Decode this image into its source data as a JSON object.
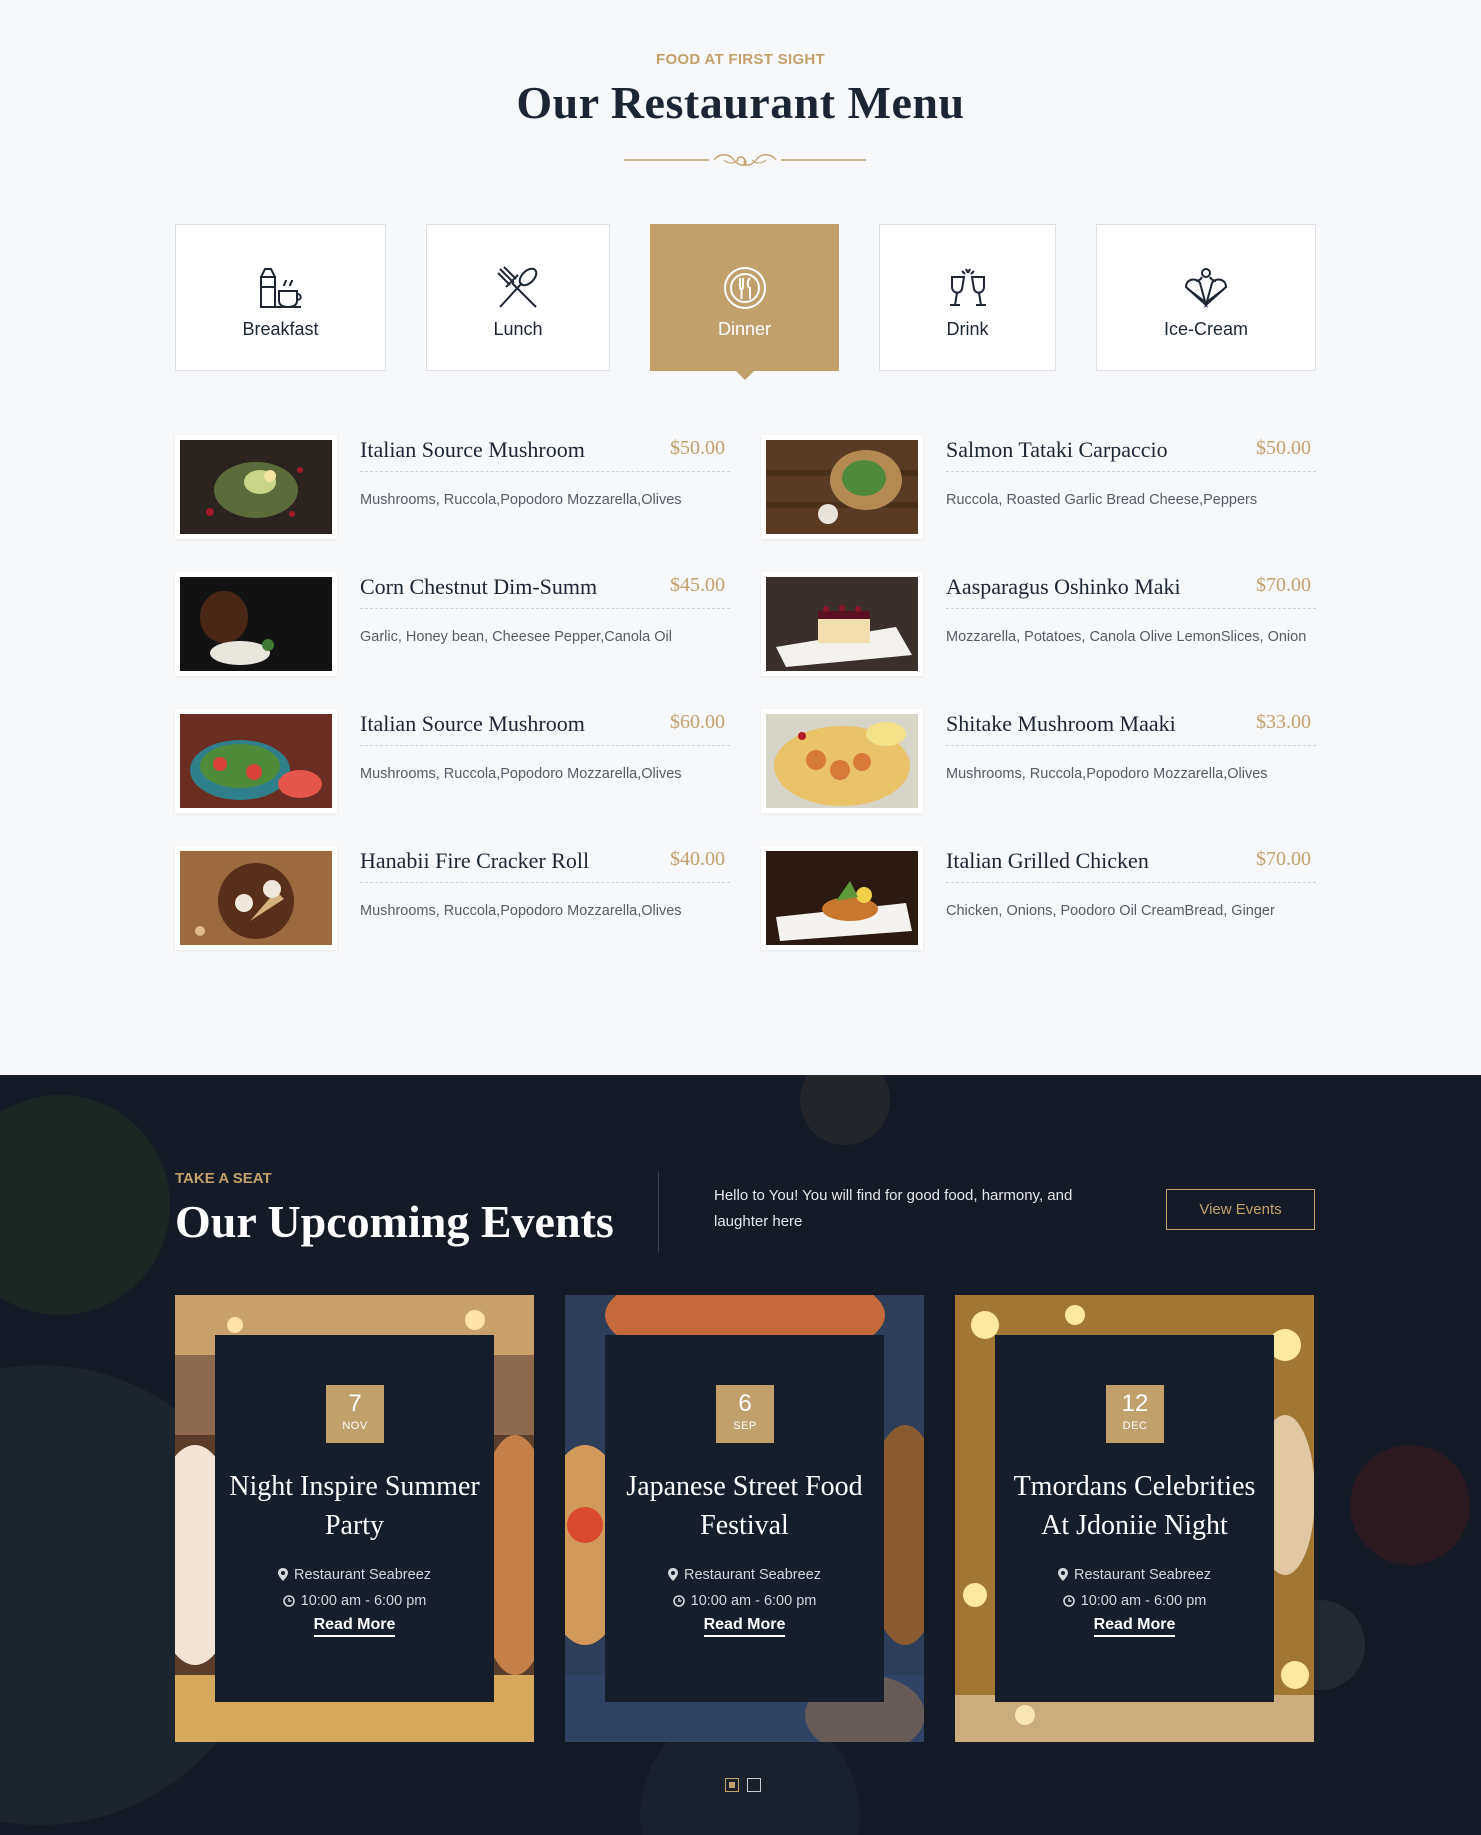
{
  "menu": {
    "eyebrow": "FOOD AT FIRST SIGHT",
    "title": "Our Restaurant Menu",
    "tabs": [
      {
        "label": "Breakfast",
        "icon": "breakfast-icon",
        "active": false
      },
      {
        "label": "Lunch",
        "icon": "cutlery-icon",
        "active": false
      },
      {
        "label": "Dinner",
        "icon": "dinner-plate-icon",
        "active": true
      },
      {
        "label": "Drink",
        "icon": "wine-glasses-icon",
        "active": false
      },
      {
        "label": "Ice-Cream",
        "icon": "ice-cream-icon",
        "active": false
      }
    ],
    "dishes": [
      {
        "name": "Italian Source Mushroom",
        "price": "$50.00",
        "desc": "Mushrooms, Ruccola,Popodoro Mozzarella,Olives"
      },
      {
        "name": "Salmon Tataki Carpaccio",
        "price": "$50.00",
        "desc": "Ruccola, Roasted Garlic Bread Cheese,Peppers"
      },
      {
        "name": "Corn Chestnut Dim-Summ",
        "price": "$45.00",
        "desc": "Garlic, Honey bean, Cheesee Pepper,Canola Oil"
      },
      {
        "name": "Aasparagus Oshinko Maki",
        "price": "$70.00",
        "desc": "Mozzarella, Potatoes, Canola Olive LemonSlices, Onion"
      },
      {
        "name": "Italian Source Mushroom",
        "price": "$60.00",
        "desc": "Mushrooms, Ruccola,Popodoro Mozzarella,Olives"
      },
      {
        "name": "Shitake Mushroom Maaki",
        "price": "$33.00",
        "desc": "Mushrooms, Ruccola,Popodoro Mozzarella,Olives"
      },
      {
        "name": "Hanabii Fire Cracker Roll",
        "price": "$40.00",
        "desc": "Mushrooms, Ruccola,Popodoro Mozzarella,Olives"
      },
      {
        "name": "Italian Grilled Chicken",
        "price": "$70.00",
        "desc": "Chicken, Onions, Poodoro Oil CreamBread, Ginger"
      }
    ]
  },
  "events": {
    "eyebrow": "TAKE A SEAT",
    "title": "Our Upcoming Events",
    "intro": "Hello to You! You will find for good food, harmony, and laughter here",
    "view_button": "View Events",
    "cards": [
      {
        "day": "7",
        "month": "NOV",
        "title": "Night Inspire Summer Party",
        "location": "Restaurant Seabreez",
        "time": "10:00 am - 6:00 pm",
        "link": "Read More"
      },
      {
        "day": "6",
        "month": "SEP",
        "title": "Japanese Street Food Festival",
        "location": "Restaurant Seabreez",
        "time": "10:00 am - 6:00 pm",
        "link": "Read More"
      },
      {
        "day": "12",
        "month": "DEC",
        "title": "Tmordans Celebrities At Jdoniie Night",
        "location": "Restaurant Seabreez",
        "time": "10:00 am - 6:00 pm",
        "link": "Read More"
      }
    ],
    "carousel": {
      "pages": 2,
      "current": 1
    }
  },
  "colors": {
    "accent": "#c2a06c",
    "dark": "#141b27",
    "light_bg": "#f7f8fa",
    "text": "#1c2533"
  }
}
